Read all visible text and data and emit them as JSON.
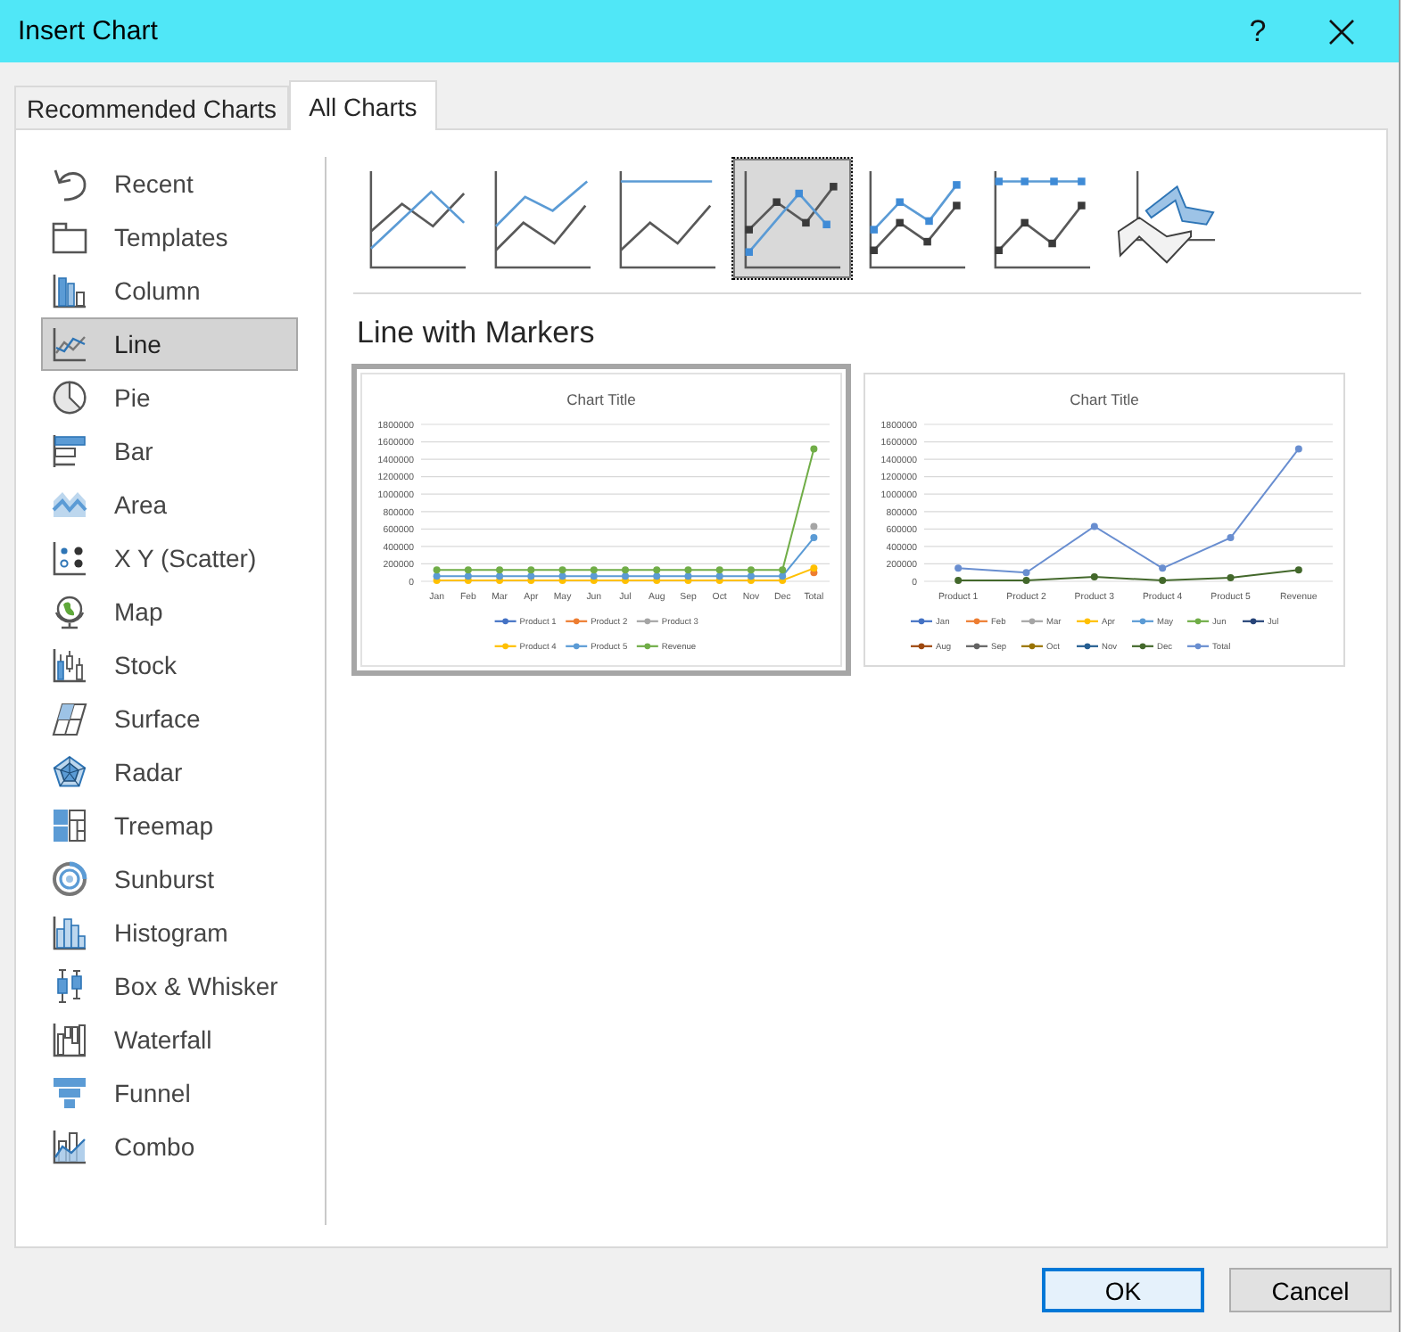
{
  "window": {
    "title": "Insert Chart",
    "help_label": "?"
  },
  "tabs": [
    {
      "label": "Recommended Charts",
      "selected": false
    },
    {
      "label": "All Charts",
      "selected": true
    }
  ],
  "sidebar": {
    "items": [
      {
        "label": "Recent",
        "kind": "recent",
        "selected": false
      },
      {
        "label": "Templates",
        "kind": "templates",
        "selected": false
      },
      {
        "label": "Column",
        "kind": "column",
        "selected": false
      },
      {
        "label": "Line",
        "kind": "line",
        "selected": true
      },
      {
        "label": "Pie",
        "kind": "pie",
        "selected": false
      },
      {
        "label": "Bar",
        "kind": "bar",
        "selected": false
      },
      {
        "label": "Area",
        "kind": "area",
        "selected": false
      },
      {
        "label": "X Y (Scatter)",
        "kind": "scatter",
        "selected": false
      },
      {
        "label": "Map",
        "kind": "map",
        "selected": false
      },
      {
        "label": "Stock",
        "kind": "stock",
        "selected": false
      },
      {
        "label": "Surface",
        "kind": "surface",
        "selected": false
      },
      {
        "label": "Radar",
        "kind": "radar",
        "selected": false
      },
      {
        "label": "Treemap",
        "kind": "treemap",
        "selected": false
      },
      {
        "label": "Sunburst",
        "kind": "sunburst",
        "selected": false
      },
      {
        "label": "Histogram",
        "kind": "histogram",
        "selected": false
      },
      {
        "label": "Box & Whisker",
        "kind": "boxwhisker",
        "selected": false
      },
      {
        "label": "Waterfall",
        "kind": "waterfall",
        "selected": false
      },
      {
        "label": "Funnel",
        "kind": "funnel",
        "selected": false
      },
      {
        "label": "Combo",
        "kind": "combo",
        "selected": false
      }
    ]
  },
  "subtypes": [
    {
      "kind": "line",
      "selected": false
    },
    {
      "kind": "stacked",
      "selected": false
    },
    {
      "kind": "percent",
      "selected": false
    },
    {
      "kind": "markers",
      "selected": true
    },
    {
      "kind": "stackedmarkers",
      "selected": false
    },
    {
      "kind": "percentmarkers",
      "selected": false
    },
    {
      "kind": "line3d",
      "selected": false
    }
  ],
  "subtype_title": "Line with Markers",
  "previews": [
    {
      "selected": true,
      "chart_data": {
        "type": "line",
        "title": "Chart Title",
        "categories": [
          "Jan",
          "Feb",
          "Mar",
          "Apr",
          "May",
          "Jun",
          "Jul",
          "Aug",
          "Sep",
          "Oct",
          "Nov",
          "Dec",
          "Total"
        ],
        "series": [
          {
            "name": "Product 1",
            "color": "#4472c4",
            "marker": "circle",
            "values": [
              null,
              null,
              null,
              null,
              null,
              null,
              null,
              null,
              null,
              null,
              null,
              null,
              null
            ]
          },
          {
            "name": "Product 2",
            "color": "#ed7d31",
            "marker": "circle",
            "values": [
              null,
              null,
              null,
              null,
              null,
              null,
              null,
              null,
              null,
              null,
              null,
              null,
              100000
            ]
          },
          {
            "name": "Product 3",
            "color": "#a5a5a5",
            "marker": "circle",
            "values": [
              null,
              null,
              null,
              null,
              null,
              null,
              null,
              null,
              null,
              null,
              null,
              null,
              630000
            ]
          },
          {
            "name": "Product 4",
            "color": "#ffc000",
            "marker": "circle",
            "values": [
              10000,
              10000,
              10000,
              10000,
              10000,
              10000,
              10000,
              10000,
              10000,
              10000,
              10000,
              10000,
              150000
            ]
          },
          {
            "name": "Product 5",
            "color": "#5b9bd5",
            "marker": "circle",
            "values": [
              60000,
              60000,
              60000,
              60000,
              60000,
              60000,
              60000,
              60000,
              60000,
              60000,
              60000,
              60000,
              500000
            ]
          },
          {
            "name": "Revenue",
            "color": "#70ad47",
            "marker": "circle",
            "values": [
              130000,
              130000,
              130000,
              130000,
              130000,
              130000,
              130000,
              130000,
              130000,
              130000,
              130000,
              130000,
              1520000
            ]
          }
        ],
        "ylim": [
          0,
          1800000
        ],
        "yticks": [
          0,
          200000,
          400000,
          600000,
          800000,
          1000000,
          1200000,
          1400000,
          1600000,
          1800000
        ],
        "grid": true,
        "legend": true
      }
    },
    {
      "selected": false,
      "chart_data": {
        "type": "line",
        "title": "Chart Title",
        "categories": [
          "Product 1",
          "Product 2",
          "Product 3",
          "Product 4",
          "Product 5",
          "Revenue"
        ],
        "series": [
          {
            "name": "Jan",
            "color": "#4472c4",
            "marker": "circle",
            "values": [
              null,
              null,
              null,
              null,
              null,
              null
            ]
          },
          {
            "name": "Feb",
            "color": "#ed7d31",
            "marker": "circle",
            "values": [
              null,
              null,
              null,
              null,
              null,
              null
            ]
          },
          {
            "name": "Mar",
            "color": "#a5a5a5",
            "marker": "circle",
            "values": [
              null,
              null,
              null,
              null,
              null,
              null
            ]
          },
          {
            "name": "Apr",
            "color": "#ffc000",
            "marker": "circle",
            "values": [
              null,
              null,
              null,
              null,
              null,
              null
            ]
          },
          {
            "name": "May",
            "color": "#5b9bd5",
            "marker": "circle",
            "values": [
              null,
              null,
              null,
              null,
              null,
              null
            ]
          },
          {
            "name": "Jun",
            "color": "#70ad47",
            "marker": "circle",
            "values": [
              null,
              null,
              null,
              null,
              null,
              null
            ]
          },
          {
            "name": "Jul",
            "color": "#264478",
            "marker": "circle",
            "values": [
              null,
              null,
              null,
              null,
              null,
              null
            ]
          },
          {
            "name": "Aug",
            "color": "#9e480e",
            "marker": "circle",
            "values": [
              null,
              null,
              null,
              null,
              null,
              null
            ]
          },
          {
            "name": "Sep",
            "color": "#636363",
            "marker": "circle",
            "values": [
              null,
              null,
              null,
              null,
              null,
              null
            ]
          },
          {
            "name": "Oct",
            "color": "#997300",
            "marker": "circle",
            "values": [
              null,
              null,
              null,
              null,
              null,
              null
            ]
          },
          {
            "name": "Nov",
            "color": "#255e91",
            "marker": "circle",
            "values": [
              null,
              null,
              null,
              null,
              null,
              null
            ]
          },
          {
            "name": "Dec",
            "color": "#43682b",
            "marker": "circle",
            "values": [
              10000,
              10000,
              50000,
              10000,
              40000,
              130000
            ]
          },
          {
            "name": "Total",
            "color": "#698ed0",
            "marker": "circle",
            "values": [
              150000,
              100000,
              630000,
              150000,
              500000,
              1520000
            ]
          }
        ],
        "ylim": [
          0,
          1800000
        ],
        "yticks": [
          0,
          200000,
          400000,
          600000,
          800000,
          1000000,
          1200000,
          1400000,
          1600000,
          1800000
        ],
        "grid": true,
        "legend": true
      }
    }
  ],
  "buttons": [
    {
      "label": "OK",
      "default": true
    },
    {
      "label": "Cancel",
      "default": false
    }
  ]
}
